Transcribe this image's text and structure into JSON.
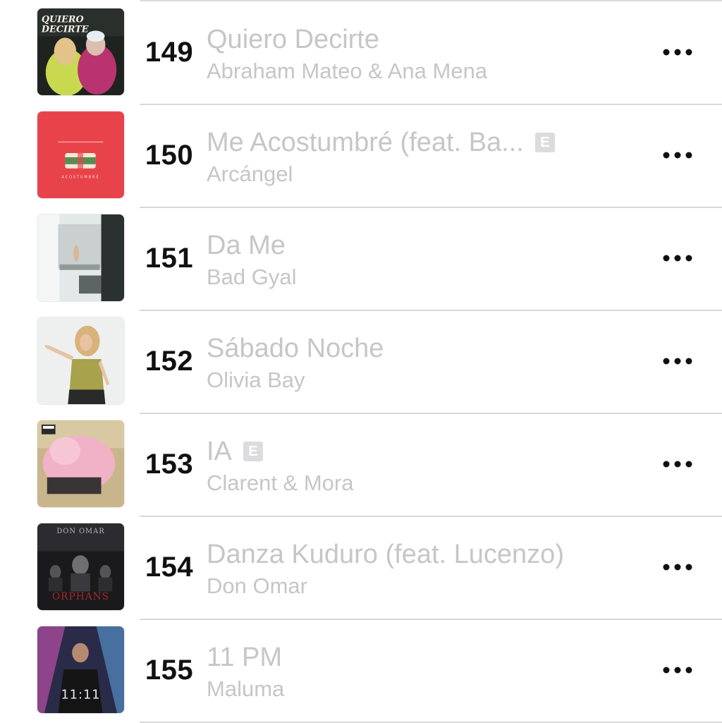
{
  "songs": [
    {
      "rank": "149",
      "title": "Quiero Decirte",
      "artist": "Abraham Mateo & Ana Mena",
      "explicit": false,
      "artwork": {
        "text": "QUIERO DECIRTE",
        "colors": [
          "#1b1f1a",
          "#c8d850",
          "#c23a7a"
        ]
      }
    },
    {
      "rank": "150",
      "title": "Me Acostumbré (feat. Ba...",
      "artist": "Arcángel",
      "explicit": true,
      "artwork": {
        "text": "ME ACOSTUMBRÉ",
        "colors": [
          "#e8434b",
          "#f1e9d6",
          "#5b8a52"
        ]
      }
    },
    {
      "rank": "151",
      "title": "Da Me",
      "artist": "Bad Gyal",
      "explicit": false,
      "artwork": {
        "text": "",
        "colors": [
          "#dfe4e4",
          "#8f9a98",
          "#2b3131"
        ]
      }
    },
    {
      "rank": "152",
      "title": "Sábado Noche",
      "artist": "Olivia Bay",
      "explicit": false,
      "artwork": {
        "text": "",
        "colors": [
          "#eef0ef",
          "#a7a24b",
          "#d9b27a"
        ]
      }
    },
    {
      "rank": "153",
      "title": "IA",
      "artist": "Clarent & Mora",
      "explicit": true,
      "artwork": {
        "text": "",
        "colors": [
          "#c9b58c",
          "#f1b2c8",
          "#3a3535"
        ]
      }
    },
    {
      "rank": "154",
      "title": "Danza Kuduro (feat. Lucenzo)",
      "artist": "Don Omar",
      "explicit": false,
      "artwork": {
        "text": "ORPHANS",
        "colors": [
          "#1a1a1c",
          "#8a8a8c",
          "#a1282a"
        ]
      }
    },
    {
      "rank": "155",
      "title": "11 PM",
      "artist": "Maluma",
      "explicit": false,
      "artwork": {
        "text": "11:11",
        "colors": [
          "#2a2b49",
          "#e05ac0",
          "#5fa9e8"
        ]
      }
    }
  ],
  "explicit_badge_label": "E",
  "icons": {
    "more": "ellipsis-icon"
  },
  "colors": {
    "rank": "#111111",
    "muted_text": "#c6c6c8",
    "divider": "#d8d8d8",
    "accent_dots": "#111111"
  }
}
